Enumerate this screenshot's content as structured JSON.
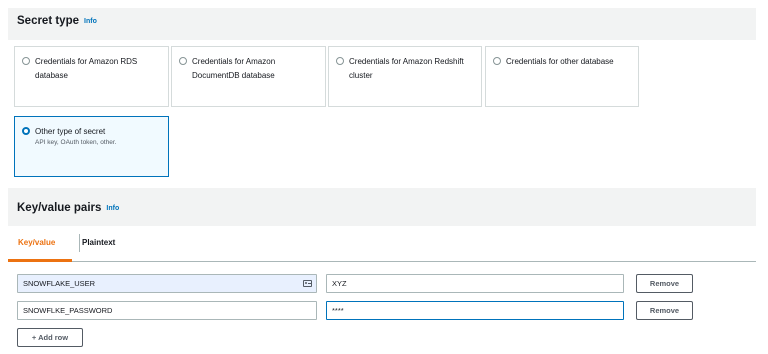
{
  "secret_type": {
    "title": "Secret type",
    "info": "Info",
    "options": [
      {
        "label": "Credentials for Amazon RDS database",
        "selected": false
      },
      {
        "label": "Credentials for Amazon DocumentDB database",
        "selected": false
      },
      {
        "label": "Credentials for Amazon Redshift cluster",
        "selected": false
      },
      {
        "label": "Credentials for other database",
        "selected": false
      },
      {
        "label": "Other type of secret",
        "description": "API key, OAuth token, other.",
        "selected": true
      }
    ]
  },
  "kv_section": {
    "title": "Key/value pairs",
    "info": "Info",
    "tabs": [
      {
        "label": "Key/value",
        "active": true
      },
      {
        "label": "Plaintext",
        "active": false
      }
    ],
    "rows": [
      {
        "key": "SNOWFLAKE_USER",
        "value": "XYZ",
        "remove_label": "Remove"
      },
      {
        "key": "SNOWFLKE_PASSWORD",
        "value": "****",
        "remove_label": "Remove"
      }
    ],
    "add_row_label": "+ Add row"
  },
  "colors": {
    "accent_blue": "#0073bb",
    "tab_active": "#ec7211",
    "header_bg": "#f2f3f3"
  }
}
